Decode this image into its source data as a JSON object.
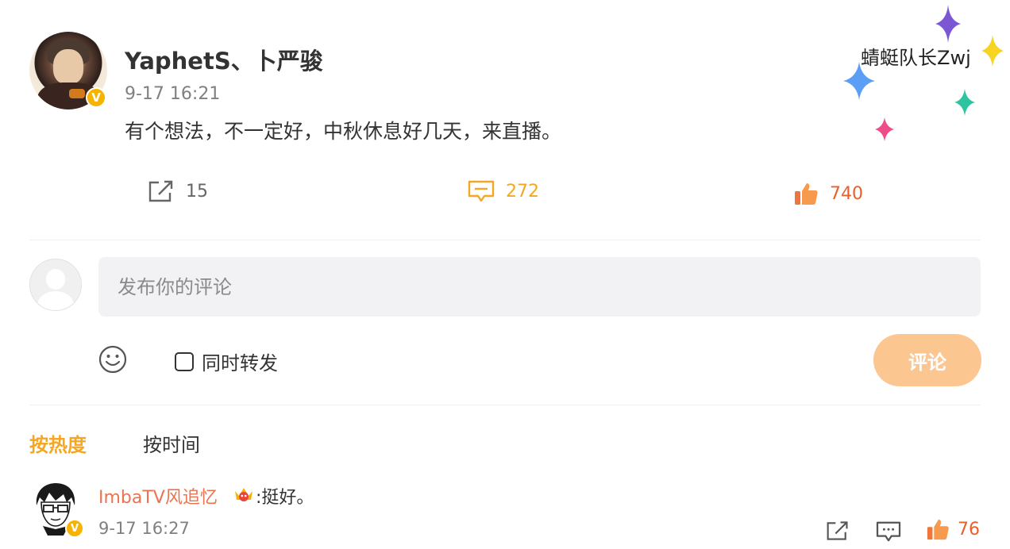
{
  "post": {
    "username": "YaphetS、卜严骏",
    "time": "9-17 16:21",
    "text": "有个想法，不一定好，中秋休息好几天，来直播。",
    "verified_badge": "V",
    "repost_count": "15",
    "comment_count": "272",
    "like_count": "740"
  },
  "composer": {
    "placeholder": "发布你的评论",
    "repost_label": "同时转发",
    "submit_label": "评论"
  },
  "sort_tabs": {
    "hot": "按热度",
    "time": "按时间"
  },
  "comments": [
    {
      "user": "ImbaTV风追忆",
      "text": ":挺好。",
      "time": "9-17 16:27",
      "like_count": "76",
      "verified_badge": "V"
    }
  ],
  "watermark": "蜻蜓队长Zwj",
  "colors": {
    "accent_orange": "#f5a623",
    "like_red": "#e8602b",
    "username_link": "#eb7350",
    "submit_disabled": "#fcc690",
    "verified": "#f6b300"
  },
  "icons": [
    "repost-icon",
    "comment-icon",
    "like-icon",
    "emoji-icon",
    "crown-icon",
    "verified-icon",
    "sparkle-icon"
  ]
}
